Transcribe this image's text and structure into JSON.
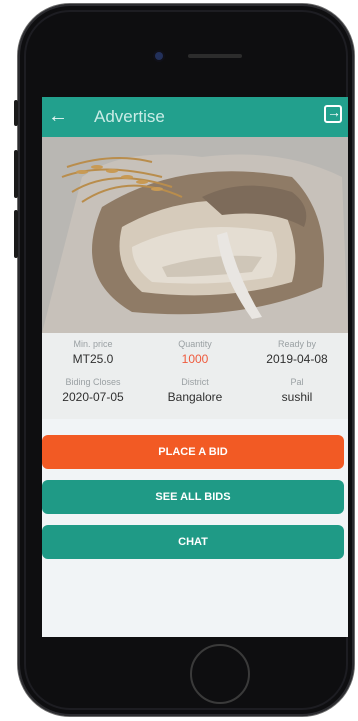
{
  "app": {
    "title": "Advertise"
  },
  "details": {
    "row1": [
      {
        "label": "Min. price",
        "value": "MT25.0"
      },
      {
        "label": "Quantity",
        "value": "1000"
      },
      {
        "label": "Ready by",
        "value": "2019-04-08"
      }
    ],
    "row2": [
      {
        "label": "Biding Closes",
        "value": "2020-07-05"
      },
      {
        "label": "District",
        "value": "Bangalore"
      },
      {
        "label": "Pal",
        "value": "sushil"
      }
    ]
  },
  "buttons": {
    "place_bid": "PLACE A BID",
    "see_all_bids": "SEE ALL BIDS",
    "chat": "CHAT"
  },
  "icons": {
    "back": "back-arrow-icon",
    "logout": "logout-icon"
  },
  "colors": {
    "appbar": "#22a08d",
    "primary_button": "#1f9a86",
    "bid_button": "#f25a24",
    "quantity": "#ef5b3e"
  }
}
